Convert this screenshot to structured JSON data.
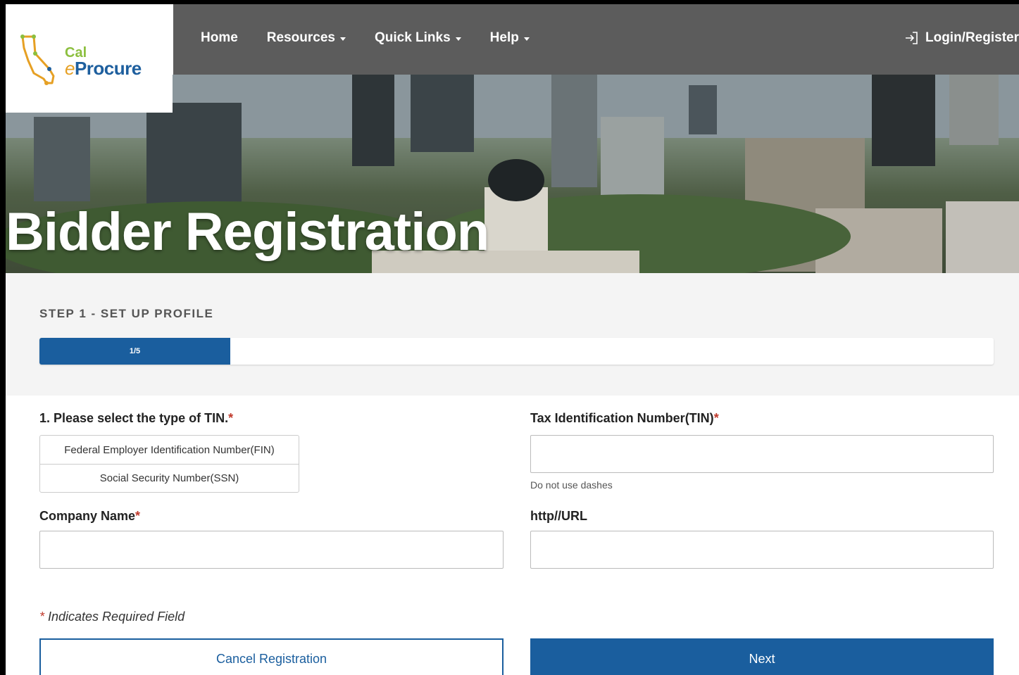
{
  "logo": {
    "line1": "Cal",
    "line2_prefix": "e",
    "line2_rest": "Procure"
  },
  "nav": {
    "items": [
      {
        "label": "Home",
        "dropdown": false
      },
      {
        "label": "Resources",
        "dropdown": true
      },
      {
        "label": "Quick Links",
        "dropdown": true
      },
      {
        "label": "Help",
        "dropdown": true
      }
    ],
    "login_label": "Login/Register"
  },
  "hero": {
    "title": "Bidder Registration"
  },
  "progress": {
    "step_label": "STEP 1 - SET UP PROFILE",
    "text": "1/5",
    "fraction": 0.2
  },
  "form": {
    "tin_type": {
      "label": "1. Please select the type of TIN.",
      "required_mark": "*",
      "options": [
        "Federal Employer Identification Number(FIN)",
        "Social Security Number(SSN)"
      ]
    },
    "tin": {
      "label": "Tax Identification Number(TIN)",
      "required_mark": "*",
      "value": "",
      "hint": "Do not use dashes"
    },
    "company": {
      "label": "Company Name",
      "required_mark": "*",
      "value": ""
    },
    "url": {
      "label": "http//URL",
      "value": ""
    },
    "required_note_mark": "*",
    "required_note": " Indicates Required Field",
    "cancel_label": "Cancel Registration",
    "next_label": "Next"
  },
  "colors": {
    "primary": "#1a5e9e",
    "nav_bg": "#5c5c5c",
    "required": "#c0392b"
  }
}
